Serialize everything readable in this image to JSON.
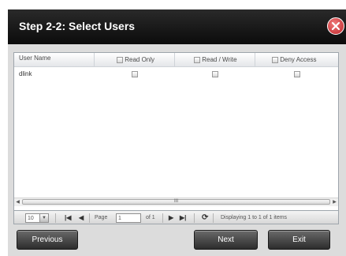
{
  "dialog": {
    "title": "Step 2-2: Select Users",
    "close_icon": "close-icon",
    "colors": {
      "titlebar": "#111111",
      "close": "#d03a3d"
    }
  },
  "grid": {
    "columns": [
      {
        "label": "User Name",
        "has_checkbox": false
      },
      {
        "label": "Read Only",
        "has_checkbox": true
      },
      {
        "label": "Read / Write",
        "has_checkbox": true
      },
      {
        "label": "Deny Access",
        "has_checkbox": true
      }
    ],
    "rows": [
      {
        "user_name": "dlink",
        "read_only": false,
        "read_write": false,
        "deny_access": false
      }
    ],
    "scroll_thumb_label": "III"
  },
  "pager": {
    "per_page": "10",
    "page_label": "Page",
    "page_value": "1",
    "of_label": "of 1",
    "display_text": "Displaying 1 to 1 of 1 items"
  },
  "buttons": {
    "previous": "Previous",
    "next": "Next",
    "exit": "Exit"
  }
}
